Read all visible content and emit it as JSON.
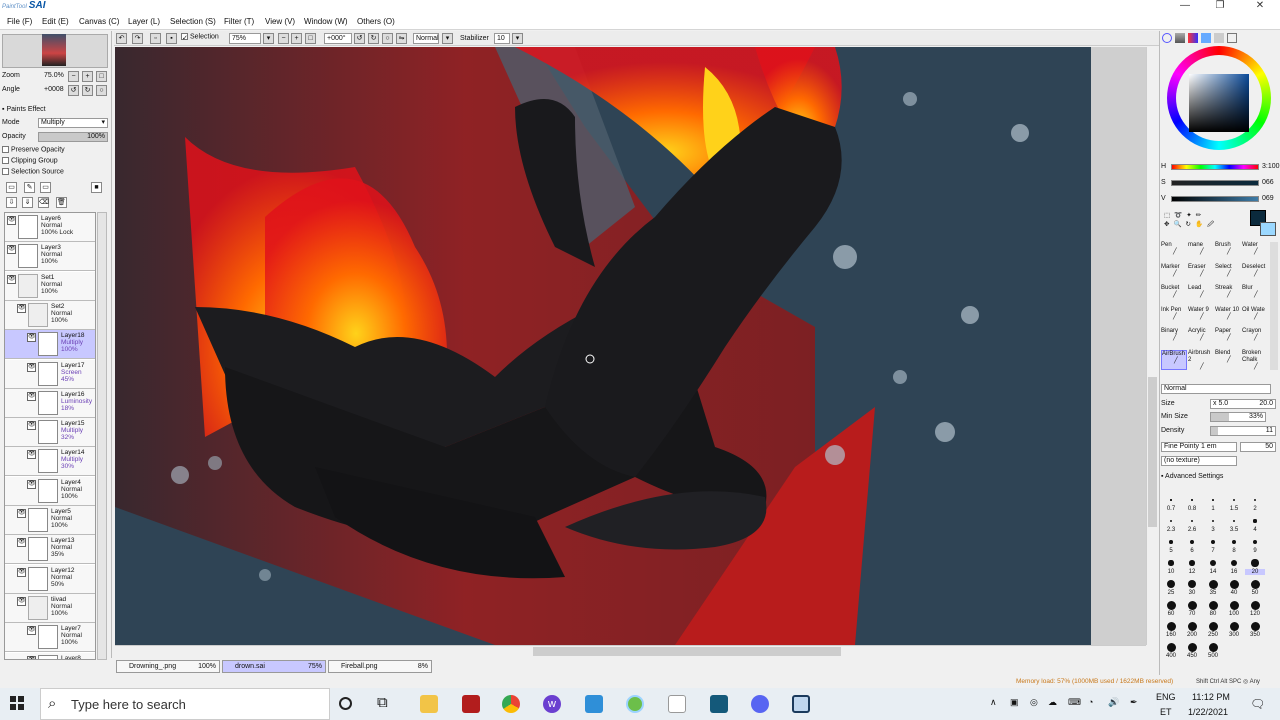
{
  "app": {
    "title": "PaintTool SAI",
    "logo_small": "PaintTool",
    "logo_big": "SAI"
  },
  "window_buttons": [
    "—",
    "❐",
    "✕"
  ],
  "menu": [
    "File (F)",
    "Edit (E)",
    "Canvas (C)",
    "Layer (L)",
    "Selection (S)",
    "Filter (T)",
    "View (V)",
    "Window (W)",
    "Others (O)"
  ],
  "toolbar": {
    "selection_label": "Selection",
    "zoom": "75%",
    "rotation": "+000°",
    "blend": "Normal",
    "stabilizer_label": "Stabilizer",
    "stabilizer": "10"
  },
  "navigator": {
    "zoom_label": "Zoom",
    "zoom": "75.0%",
    "angle_label": "Angle",
    "angle": "+0008"
  },
  "paint_effect": {
    "title": "Paints Effect",
    "mode_label": "Mode",
    "mode": "Multiply",
    "opacity_label": "Opacity",
    "opacity": "100%",
    "preserve": "Preserve Opacity",
    "clipping": "Clipping Group",
    "selection_source": "Selection Source"
  },
  "layers": [
    {
      "name": "Layer6",
      "blend": "Normal",
      "op": "100% Lock",
      "indent": 0
    },
    {
      "name": "Layer3",
      "blend": "Normal",
      "op": "100%",
      "indent": 0
    },
    {
      "name": "Set1",
      "blend": "Normal",
      "op": "100%",
      "indent": 0,
      "folder": true
    },
    {
      "name": "Set2",
      "blend": "Normal",
      "op": "100%",
      "indent": 1,
      "folder": true
    },
    {
      "name": "Layer18",
      "blend": "Multiply",
      "op": "100%",
      "indent": 2,
      "selected": true,
      "color": true
    },
    {
      "name": "Layer17",
      "blend": "Screen",
      "op": "45%",
      "indent": 2,
      "color": true
    },
    {
      "name": "Layer16",
      "blend": "Luminosity",
      "op": "18%",
      "indent": 2,
      "color": true
    },
    {
      "name": "Layer15",
      "blend": "Multiply",
      "op": "32%",
      "indent": 2,
      "color": true
    },
    {
      "name": "Layer14",
      "blend": "Multiply",
      "op": "30%",
      "indent": 2,
      "color": true
    },
    {
      "name": "Layer4",
      "blend": "Normal",
      "op": "100%",
      "indent": 2
    },
    {
      "name": "Layer5",
      "blend": "Normal",
      "op": "100%",
      "indent": 1
    },
    {
      "name": "Layer13",
      "blend": "Normal",
      "op": "35%",
      "indent": 1
    },
    {
      "name": "Layer12",
      "blend": "Normal",
      "op": "50%",
      "indent": 1
    },
    {
      "name": "tiivad",
      "blend": "Normal",
      "op": "100%",
      "indent": 1,
      "folder": true
    },
    {
      "name": "Layer7",
      "blend": "Normal",
      "op": "100%",
      "indent": 2
    },
    {
      "name": "Layer8",
      "blend": "",
      "op": "",
      "indent": 2
    }
  ],
  "tabs": [
    {
      "name": "Drowning_.png",
      "zoom": "100%"
    },
    {
      "name": "drown.sai",
      "zoom": "75%"
    },
    {
      "name": "Fireball.png",
      "zoom": "8%"
    }
  ],
  "color": {
    "h_label": "H",
    "h": "3:100",
    "s_label": "S",
    "s": "066",
    "v_label": "V",
    "v": "069",
    "primary": "#0b2a3d",
    "secondary": "#9bd8ff"
  },
  "tools": [
    [
      "Pen",
      "mane",
      "Brush",
      "Water"
    ],
    [
      "Marker",
      "Eraser",
      "Select",
      "Deselect"
    ],
    [
      "Bucket",
      "Lead",
      "Streak",
      "Blur"
    ],
    [
      "Ink Pen",
      "Water 9",
      "Water 10",
      "Oil Wate"
    ],
    [
      "Binary",
      "Acrylic",
      "Paper",
      "Crayon"
    ],
    [
      "AirBrush",
      "Airbrush 2",
      "Blend",
      "Broken Chalk"
    ]
  ],
  "brush": {
    "mode": "Normal",
    "size_label": "Size",
    "size_mult": "x 5.0",
    "size": "20.0",
    "minsize_label": "Min Size",
    "minsize": "33%",
    "density_label": "Density",
    "density": "11",
    "shape": "Fine Pointy 1 em",
    "shape_val": "50",
    "texture": "(no texture)",
    "advanced": "Advanced Settings"
  },
  "brush_sizes": [
    "0.7",
    "0.8",
    "1",
    "1.5",
    "2",
    "2.3",
    "2.6",
    "3",
    "3.5",
    "4",
    "5",
    "6",
    "7",
    "8",
    "9",
    "10",
    "12",
    "14",
    "16",
    "20",
    "25",
    "30",
    "35",
    "40",
    "50",
    "60",
    "70",
    "80",
    "100",
    "120",
    "160",
    "200",
    "250",
    "300",
    "350",
    "400",
    "450",
    "500"
  ],
  "status": {
    "memory": "Memory load: 57% (1000MB used / 1622MB reserved)",
    "keys": "Shift Ctrl Alt SPC ◎ Any"
  },
  "taskbar": {
    "search": "Type here to search",
    "lang": "ENG",
    "layout": "ET",
    "time": "11:12 PM",
    "date": "1/22/2021"
  }
}
